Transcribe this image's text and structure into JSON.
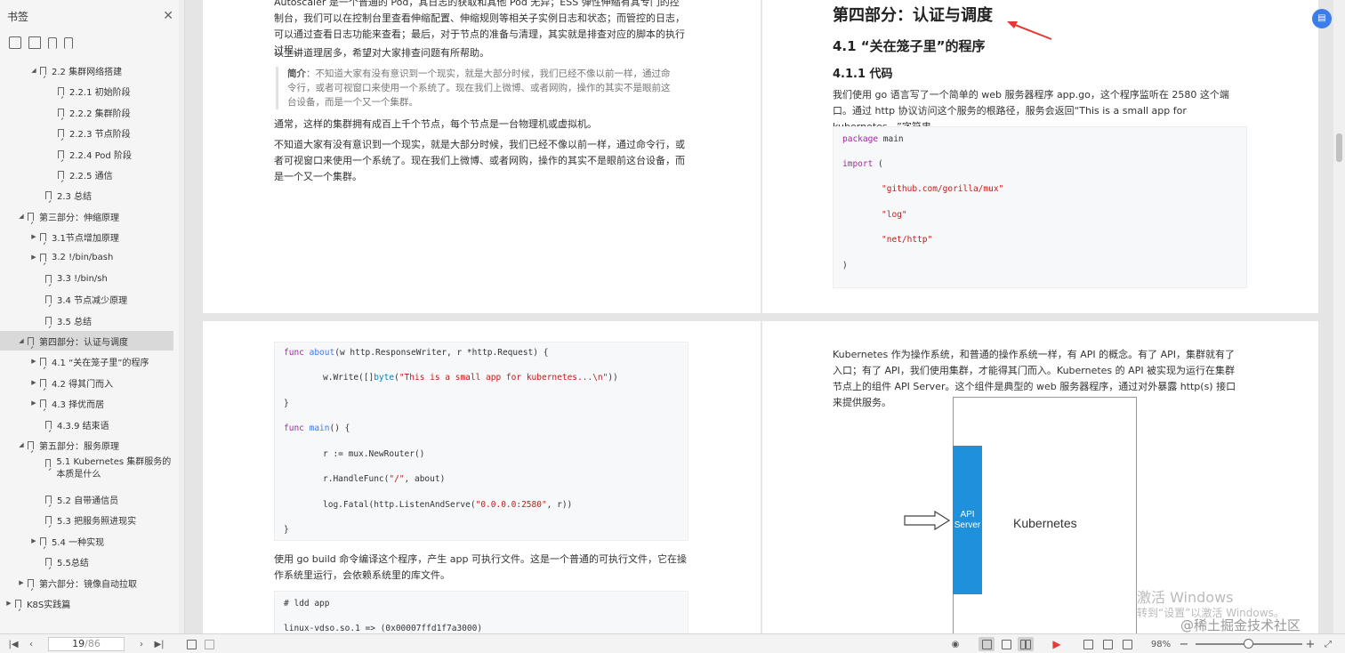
{
  "sidebar": {
    "title": "书签",
    "close": "✕",
    "items": [
      {
        "label": "2.2 集群网络搭建",
        "arrow": "◢"
      },
      {
        "label": "2.2.1 初始阶段",
        "arrow": ""
      },
      {
        "label": "2.2.2 集群阶段",
        "arrow": ""
      },
      {
        "label": "2.2.3 节点阶段",
        "arrow": ""
      },
      {
        "label": "2.2.4 Pod 阶段",
        "arrow": ""
      },
      {
        "label": "2.2.5 通信",
        "arrow": ""
      },
      {
        "label": "2.3 总结",
        "arrow": ""
      },
      {
        "label": "第三部分：伸缩原理",
        "arrow": "◢"
      },
      {
        "label": "3.1节点增加原理",
        "arrow": "▶"
      },
      {
        "label": "3.2 !/bin/bash",
        "arrow": "▶"
      },
      {
        "label": "3.3 !/bin/sh",
        "arrow": ""
      },
      {
        "label": "3.4 节点减少原理",
        "arrow": ""
      },
      {
        "label": "3.5 总结",
        "arrow": ""
      },
      {
        "label": "第四部分：认证与调度",
        "arrow": "◢"
      },
      {
        "label": "4.1 “关在笼子里”的程序",
        "arrow": "▶"
      },
      {
        "label": "4.2 得其门而入",
        "arrow": "▶"
      },
      {
        "label": "4.3 择优而居",
        "arrow": "▶"
      },
      {
        "label": "4.3.9 结束语",
        "arrow": ""
      },
      {
        "label": "第五部分：服务原理",
        "arrow": "◢"
      },
      {
        "label": "5.1 Kubernetes 集群服务的本质是什么",
        "arrow": ""
      },
      {
        "label": "5.2 自带通信员",
        "arrow": ""
      },
      {
        "label": "5.3 把服务照进现实",
        "arrow": ""
      },
      {
        "label": "5.4 一种实现",
        "arrow": "▶"
      },
      {
        "label": "5.5总结",
        "arrow": ""
      },
      {
        "label": "第六部分：镜像自动拉取",
        "arrow": "▶"
      },
      {
        "label": "K8S实践篇",
        "arrow": "▶"
      }
    ]
  },
  "page1": {
    "para1": "Autoscaler 是一个普通的 Pod，其日志的获取和其他 Pod 无异；ESS 弹性伸缩有其专门的控制台，我们可以在控制台里查看伸缩配置、伸缩规则等相关子实例日志和状态；而管控的日志，可以通过查看日志功能来查看；最后，对于节点的准备与清理，其实就是排查对应的脚本的执行过程。",
    "para2": "以上讲道理居多，希望对大家排查问题有所帮助。",
    "quote_label": "简介",
    "quote_text": "：不知道大家有没有意识到一个现实，就是大部分时候，我们已经不像以前一样，通过命令行，或者可视窗口来使用一个系统了。现在我们上微博、或者网购，操作的其实不是眼前这台设备，而是一个又一个集群。",
    "para3": "通常，这样的集群拥有成百上千个节点，每个节点是一台物理机或虚拟机。",
    "para4": "不知道大家有没有意识到一个现实，就是大部分时候，我们已经不像以前一样，通过命令行，或者可视窗口来使用一个系统了。现在我们上微博、或者网购，操作的其实不是眼前这台设备，而是一个又一个集群。"
  },
  "page2": {
    "h1": "第四部分：认证与调度",
    "h2": "4.1 “关在笼子里”的程序",
    "h3": "4.1.1 代码",
    "para": "我们使用 go 语言写了一个简单的 web 服务器程序 app.go，这个程序监听在 2580 这个端口。通过 http 协议访问这个服务的根路径，服务会返回“This is a small app for kubernetes...”字符串。",
    "code_kw_package": "package",
    "code_pkg_name": " main",
    "code_kw_import": "import",
    "code_paren_open": " (",
    "code_imp1": "\"github.com/gorilla/mux\"",
    "code_imp2": "\"log\"",
    "code_imp3": "\"net/http\"",
    "code_paren_close": ")"
  },
  "page3": {
    "c1_kw": "func",
    "c1_fn": " about",
    "c1_rest": "(w http.ResponseWriter, r *http.Request) {",
    "c2_a": "w.Write([]",
    "c2_ty": "byte",
    "c2_b": "(",
    "c2_str": "\"This is a small app for kubernetes...\\n\"",
    "c2_c": "))",
    "c3": "}",
    "c4_kw": "func",
    "c4_fn": " main",
    "c4_rest": "() {",
    "c5": "r := mux.NewRouter()",
    "c6_a": "r.HandleFunc(",
    "c6_str": "\"/\"",
    "c6_b": ", about)",
    "c7_a": "log.Fatal(http.ListenAndServe(",
    "c7_str": "\"0.0.0.0:2580\"",
    "c7_b": ", r))",
    "c8": "}",
    "para": "使用 go build 命令编译这个程序，产生 app 可执行文件。这是一个普通的可执行文件，它在操作系统里运行，会依赖系统里的库文件。",
    "code2_l1": "# ldd app",
    "code2_l2": "linux-vdso.so.1 => (0x00007ffd1f7a3000)"
  },
  "page4": {
    "para": "Kubernetes 作为操作系统，和普通的操作系统一样，有 API 的概念。有了 API，集群就有了入口；有了 API，我们使用集群，才能得其门而入。Kubernetes 的 API 被实现为运行在集群节点上的组件 API Server。这个组件是典型的 web 服务器程序，通过对外暴露 http(s) 接口来提供服务。",
    "api_label": "API Server",
    "k8s_label": "Kubernetes",
    "watermark1": "激活 Windows",
    "watermark2": "转到“设置”以激活 Windows。",
    "watermark3": "@稀土掘金技术社区"
  },
  "bottombar": {
    "page_current": "19",
    "page_total": "/86",
    "zoom": "98%"
  },
  "colors": {
    "accent": "#3b7de9",
    "api_box": "#1e90dc",
    "annotation": "#e53935"
  }
}
